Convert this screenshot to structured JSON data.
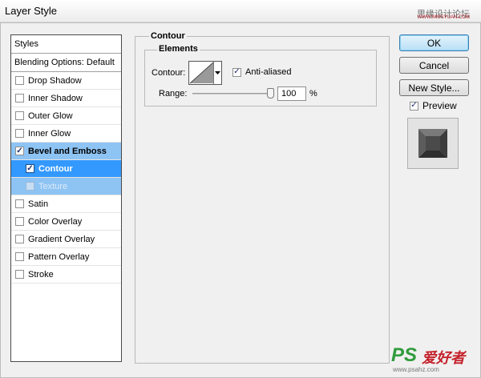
{
  "window": {
    "title": "Layer Style",
    "watermark": "思缘设计论坛",
    "watermark_sub": "WWW.MISSYUAN.COM"
  },
  "styles_panel": {
    "header": "Styles",
    "blending_options": "Blending Options: Default",
    "items": [
      {
        "label": "Drop Shadow",
        "checked": false
      },
      {
        "label": "Inner Shadow",
        "checked": false
      },
      {
        "label": "Outer Glow",
        "checked": false
      },
      {
        "label": "Inner Glow",
        "checked": false
      },
      {
        "label": "Bevel and Emboss",
        "checked": true
      },
      {
        "label": "Contour",
        "checked": true
      },
      {
        "label": "Texture",
        "checked": false
      },
      {
        "label": "Satin",
        "checked": false
      },
      {
        "label": "Color Overlay",
        "checked": false
      },
      {
        "label": "Gradient Overlay",
        "checked": false
      },
      {
        "label": "Pattern Overlay",
        "checked": false
      },
      {
        "label": "Stroke",
        "checked": false
      }
    ]
  },
  "contour_section": {
    "title": "Contour",
    "elements_title": "Elements",
    "contour_label": "Contour:",
    "anti_aliased_label": "Anti-aliased",
    "anti_aliased_checked": true,
    "range_label": "Range:",
    "range_value": "100",
    "range_unit": "%"
  },
  "buttons": {
    "ok": "OK",
    "cancel": "Cancel",
    "new_style": "New Style...",
    "preview_label": "Preview",
    "preview_checked": true
  },
  "footer_watermark": {
    "logo": "PS",
    "cn": "爱好者",
    "url": "www.psahz.com"
  },
  "colors": {
    "selected_parent": "#8ec4f4",
    "selected_active": "#3399ff",
    "ok_button": "#b7dff6"
  }
}
